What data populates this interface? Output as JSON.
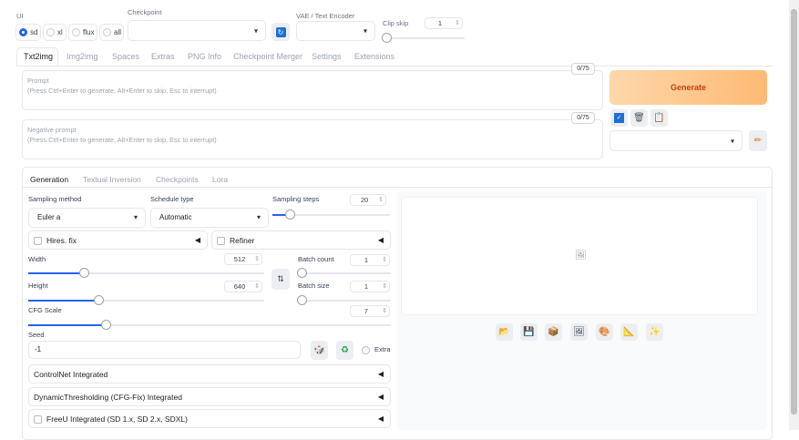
{
  "top": {
    "ui_label": "UI",
    "ui_options": [
      "sd",
      "xl",
      "flux",
      "all"
    ],
    "ui_selected": "sd",
    "checkpoint_label": "Checkpoint",
    "checkpoint_value": "",
    "vae_label": "VAE / Text Encoder",
    "vae_value": "",
    "clip_skip_label": "Clip skip",
    "clip_skip_value": "1",
    "clip_skip_fraction": 0
  },
  "tabs": [
    "Txt2img",
    "Img2img",
    "Spaces",
    "Extras",
    "PNG Info",
    "Checkpoint Merger",
    "Settings",
    "Extensions"
  ],
  "prompt": {
    "label": "Prompt",
    "placeholder": "(Press Ctrl+Enter to generate, Alt+Enter to skip, Esc to interrupt)",
    "counter": "0/75"
  },
  "negative": {
    "label": "Negative prompt",
    "placeholder": "(Press Ctrl+Enter to generate, Alt+Enter to skip, Esc to interrupt)",
    "counter": "0/75"
  },
  "generate_label": "Generate",
  "accent": "#fdba74",
  "subtabs": [
    "Generation",
    "Textual Inversion",
    "Checkpoints",
    "Lora"
  ],
  "gen": {
    "sampling_method_label": "Sampling method",
    "sampling_method": "Euler a",
    "schedule_type_label": "Schedule type",
    "schedule_type": "Automatic",
    "steps_label": "Sampling steps",
    "steps": "20",
    "steps_fraction": 0.13,
    "hires_label": "Hires. fix",
    "refiner_label": "Refiner",
    "width_label": "Width",
    "width": "512",
    "width_fraction": 0.235,
    "height_label": "Height",
    "height": "640",
    "height_fraction": 0.297,
    "batch_count_label": "Batch count",
    "batch_count": "1",
    "batch_count_fraction": 0,
    "batch_size_label": "Batch size",
    "batch_size": "1",
    "batch_size_fraction": 0,
    "cfg_label": "CFG Scale",
    "cfg": "7",
    "cfg_fraction": 0.215,
    "seed_label": "Seed",
    "seed": "-1",
    "extra_label": "Extra",
    "accordions": [
      "ControlNet Integrated",
      "DynamicThresholding (CFG-Fix) Integrated",
      "FreeU Integrated (SD 1.x, SD 2.x, SDXL)"
    ]
  }
}
